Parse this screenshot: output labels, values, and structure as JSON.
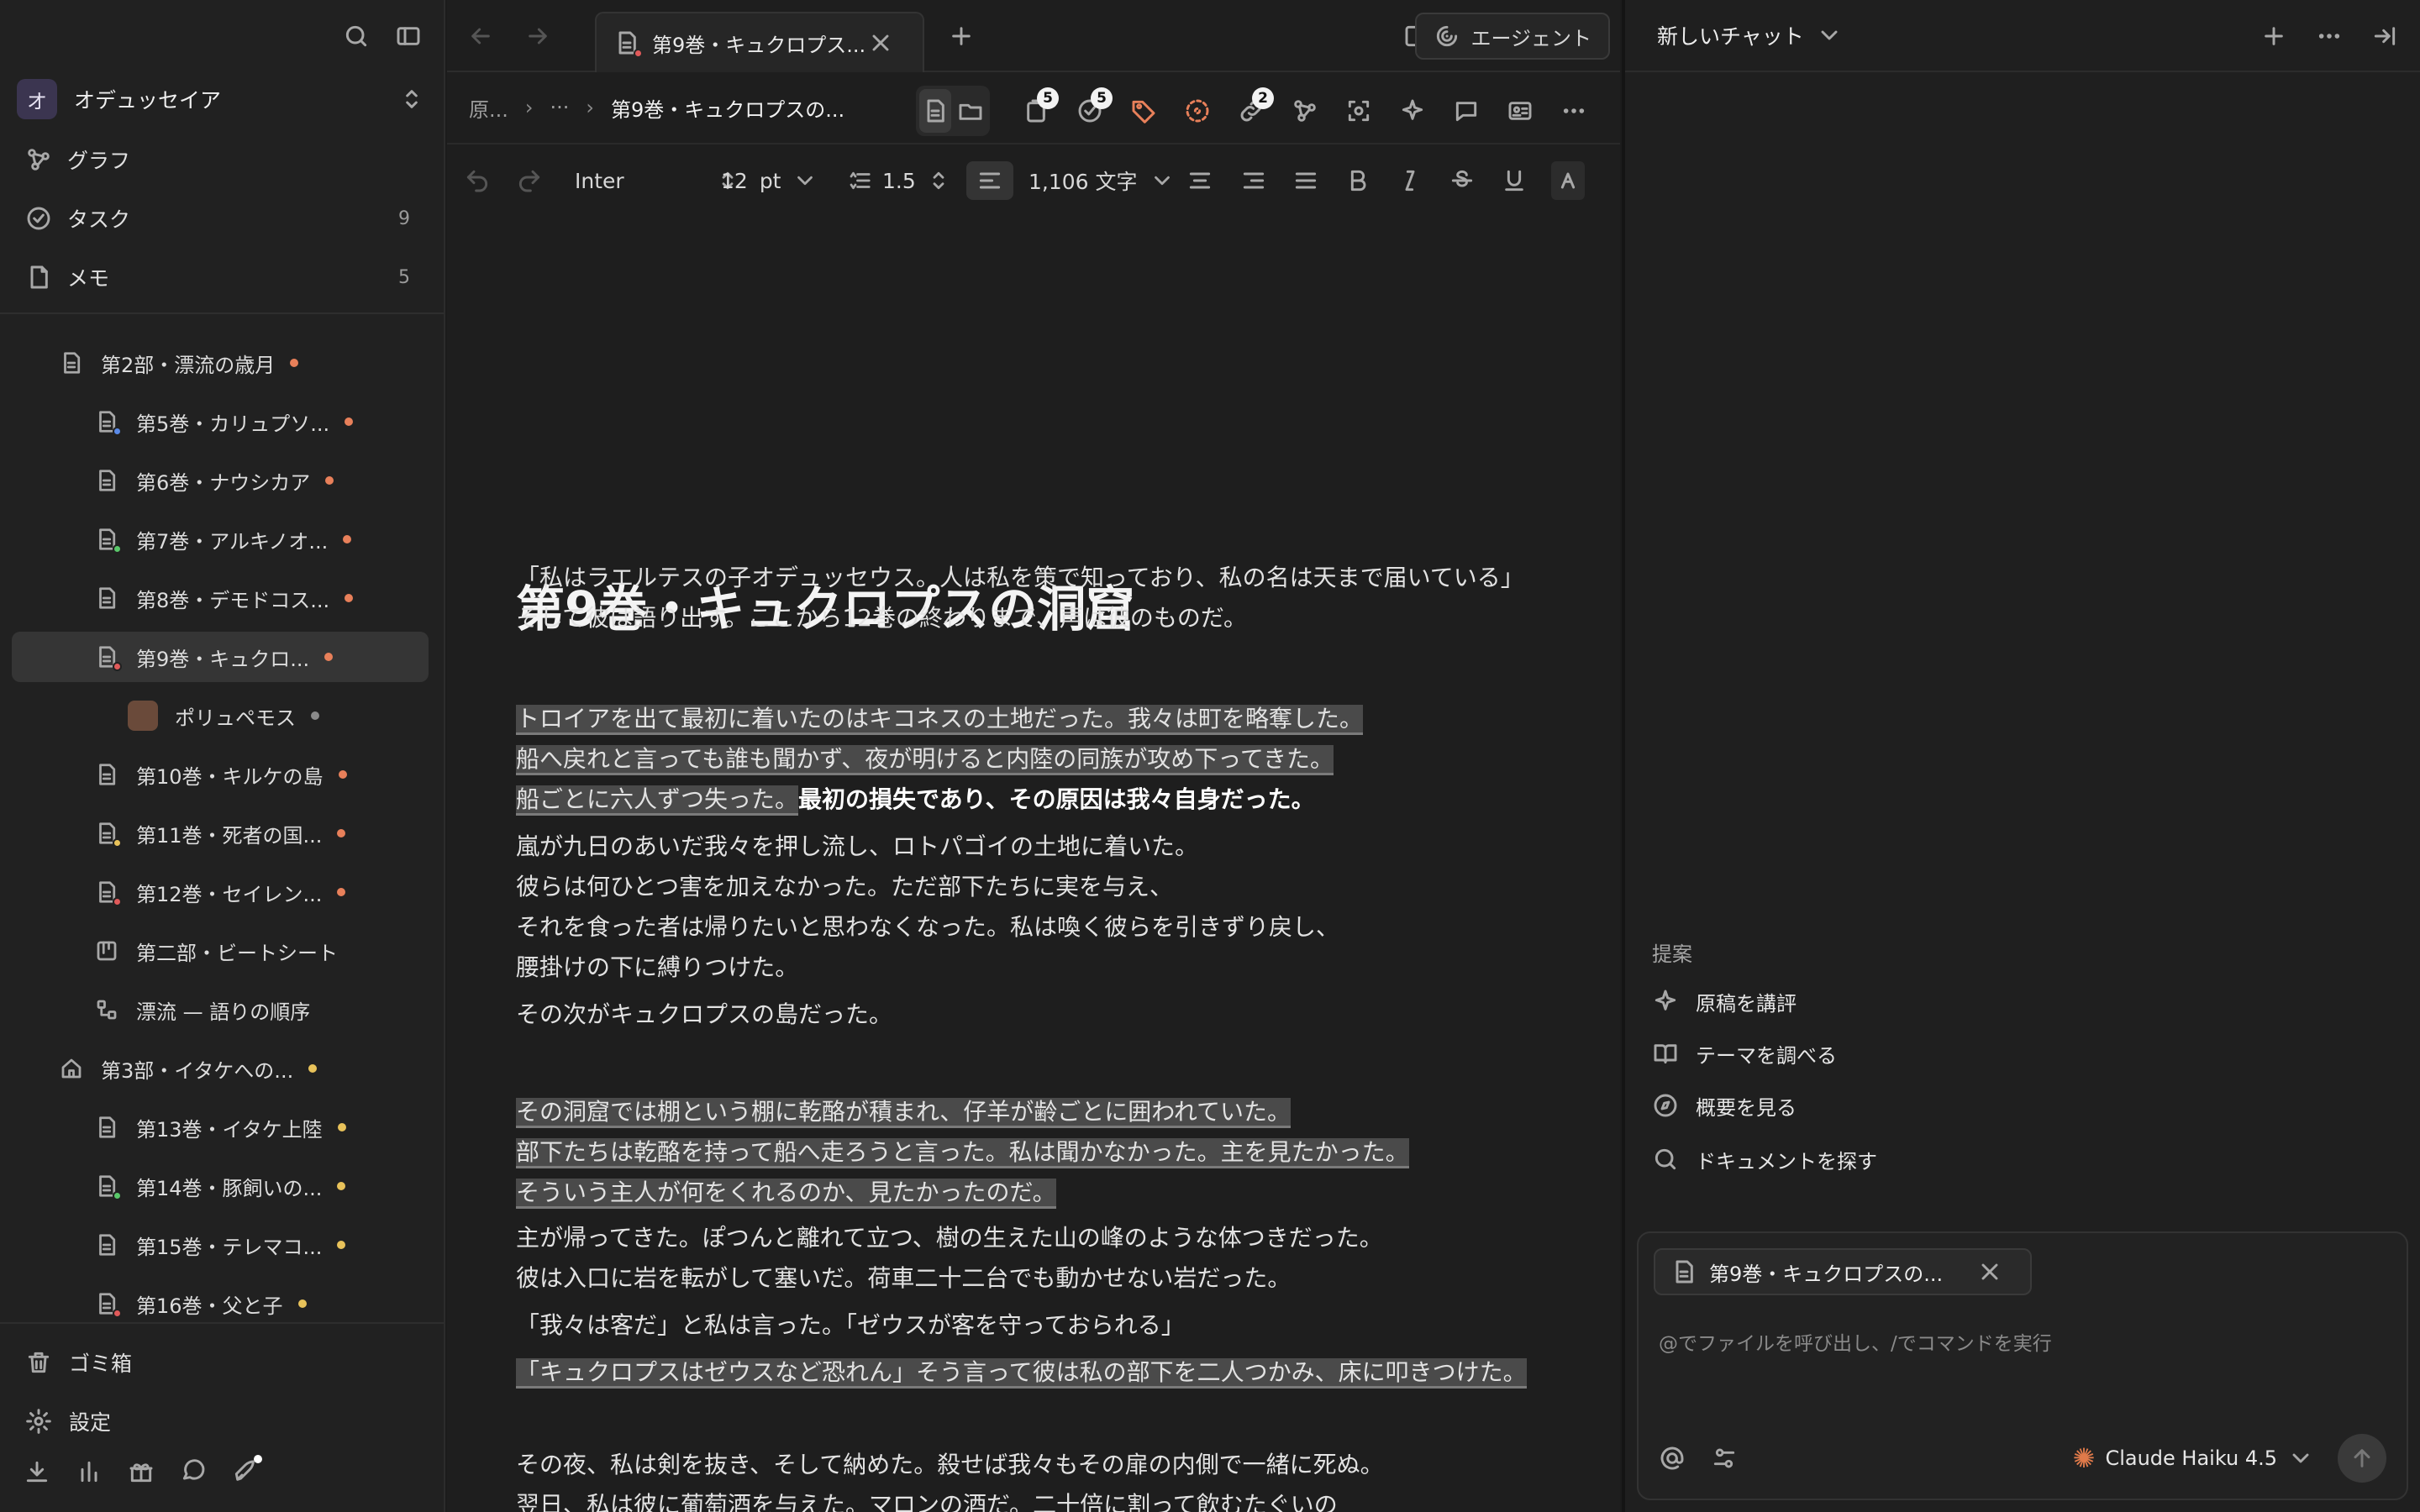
{
  "sidebar": {
    "workspace": {
      "avatar": "オ",
      "name": "オデュッセイア"
    },
    "nav": [
      {
        "label": "グラフ",
        "count": ""
      },
      {
        "label": "タスク",
        "count": "9"
      },
      {
        "label": "メモ",
        "count": "5"
      }
    ],
    "tree": [
      {
        "label": "第2部・漂流の歳月",
        "dot": "#e8805a"
      },
      {
        "label": "第5巻・カリュプソ...",
        "dot": "#e8805a"
      },
      {
        "label": "第6巻・ナウシカア",
        "dot": "#e8805a"
      },
      {
        "label": "第7巻・アルキノオ...",
        "dot": "#e8805a"
      },
      {
        "label": "第8巻・デモドコス...",
        "dot": "#e8805a"
      },
      {
        "label": "第9巻・キュクロ...",
        "dot": "#e8805a"
      },
      {
        "label": "ポリュペモス",
        "dot": "#8a8a8a"
      },
      {
        "label": "第10巻・キルケの島",
        "dot": "#e8805a"
      },
      {
        "label": "第11巻・死者の国...",
        "dot": "#e8805a"
      },
      {
        "label": "第12巻・セイレン...",
        "dot": "#e8805a"
      },
      {
        "label": "第二部・ビートシート",
        "dot": ""
      },
      {
        "label": "漂流 — 語りの順序",
        "dot": ""
      },
      {
        "label": "第3部・イタケへの...",
        "dot": "#e8c25a"
      },
      {
        "label": "第13巻・イタケ上陸",
        "dot": "#e8c25a"
      },
      {
        "label": "第14巻・豚飼いの...",
        "dot": "#e8c25a"
      },
      {
        "label": "第15巻・テレマコ...",
        "dot": "#e8c25a"
      },
      {
        "label": "第16巻・父と子",
        "dot": "#e8c25a"
      }
    ],
    "footer": {
      "trash": "ゴミ箱",
      "settings": "設定"
    }
  },
  "editor": {
    "tab_title": "第9巻・キュクロプス...",
    "agent_label": "エージェント",
    "breadcrumb": {
      "root": "原...",
      "ellipsis": "···",
      "current": "第9巻・キュクロプスの..."
    },
    "badges": {
      "files": "5",
      "tasks": "5",
      "links": "2"
    },
    "format": {
      "font": "Inter",
      "size": "12",
      "unit": "pt",
      "line_height": "1.5",
      "char_count": "1,106 文字"
    },
    "title": "第9巻・キュクロプスの洞窟",
    "paragraphs": {
      "p1a": "「私はラエルテスの子オデュッセウス。人は私を策で知っており、私の名は天まで届いている」",
      "p1b": "そして彼は語り出す。ここから12巻の終わりまで、声は彼のものだ。",
      "h1": "トロイアを出て最初に着いたのはキコネスの土地だった。我々は町を略奪した。",
      "h2": "船へ戻れと言っても誰も聞かず、夜が明けると内陸の同族が攻め下ってきた。",
      "h3": "船ごとに六人ずつ失った。",
      "h3b": "最初の損失であり、その原因は我々自身だった。",
      "l1": "嵐が九日のあいだ我々を押し流し、ロトパゴイの土地に着いた。",
      "l2": "彼らは何ひとつ害を加えなかった。ただ部下たちに実を与え、",
      "l3": "それを食った者は帰りたいと思わなくなった。私は喚く彼らを引きずり戻し、",
      "l4": "腰掛けの下に縛りつけた。",
      "l5": "その次がキュクロプスの島だった。",
      "h4": "その洞窟では棚という棚に乾酪が積まれ、仔羊が齢ごとに囲われていた。",
      "h5": "部下たちは乾酪を持って船へ走ろうと言った。私は聞かなかった。主を見たかった。",
      "h6": "そういう主人が何をくれるのか、見たかったのだ。",
      "m1": "主が帰ってきた。ぽつんと離れて立つ、樹の生えた山の峰のような体つきだった。",
      "m2": "彼は入口に岩を転がして塞いだ。荷車二十二台でも動かせない岩だった。",
      "m3": "「我々は客だ」と私は言った。「ゼウスが客を守っておられる」",
      "h7": "「キュクロプスはゼウスなど恐れん」そう言って彼は私の部下を二人つかみ、床に叩きつけた。",
      "e1": "その夜、私は剣を抜き、そして納めた。殺せば我々もその扉の内側で一緒に死ぬ。",
      "e2": "翌日、私は彼に葡萄酒を与えた。マロンの酒だ。二十倍に割って飲むたぐいの"
    }
  },
  "chat": {
    "title": "新しいチャット",
    "suggestions_heading": "提案",
    "suggestions": [
      "原稿を講評",
      "テーマを調べる",
      "概要を見る",
      "ドキュメントを探す"
    ],
    "attachment": "第9巻・キュクロプスの...",
    "placeholder": "@でファイルを呼び出し、/でコマンドを実行",
    "model": "Claude Haiku 4.5",
    "model_icon_color": "#e07a4a"
  }
}
